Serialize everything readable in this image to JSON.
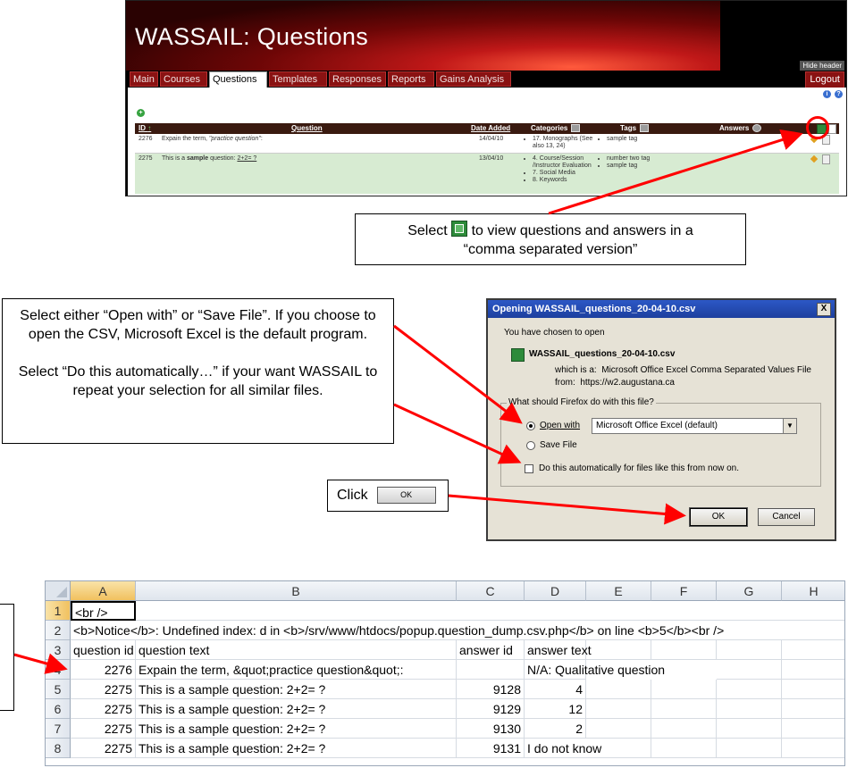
{
  "wassail": {
    "title": "WASSAIL: Questions",
    "hide_header": "Hide header",
    "tabs": [
      "Main",
      "Courses",
      "Questions",
      "Templates",
      "Responses",
      "Reports",
      "Gains Analysis"
    ],
    "active_tab": "Questions",
    "logout": "Logout",
    "table_headers": {
      "id": "ID",
      "question": "Question",
      "date_added": "Date Added",
      "categories": "Categories",
      "tags": "Tags",
      "answers": "Answers"
    },
    "rows": [
      {
        "id": "2276",
        "question_prefix": "Expain the term, ",
        "question_em": "\"practice question\"",
        "question_suffix": ":",
        "date": "14/04/10",
        "categories": [
          "17. Monographs (See also 13, 24)"
        ],
        "tags": [
          "sample tag"
        ]
      },
      {
        "id": "2275",
        "question_prefix": "This is a ",
        "question_bold": "sample",
        "question_mid": " question: ",
        "question_link": "2+2= ?",
        "date": "13/04/10",
        "categories": [
          "4. Course/Session /Instructor Evaluation",
          "7. Social Media",
          "8. Keywords"
        ],
        "tags": [
          "number two tag",
          "sample tag"
        ]
      }
    ],
    "colors": {
      "banner": "#a01010",
      "tab": "#8a1212",
      "row_highlight": "#d7ebd2",
      "header": "#3a1a10"
    }
  },
  "callouts": {
    "select_pre": "Select",
    "select_post_line1": "to view questions and answers in a",
    "select_line2": "“comma separated version”",
    "open_save": "Select either “Open with” or “Save File”. If you choose to open the CSV, Microsoft Excel is the default program.",
    "automatic": "Select “Do this automatically…” if your want WASSAIL to repeat your selection for all similar files.",
    "click": "Click",
    "click_ok_btn": "OK"
  },
  "dialog": {
    "title": "Opening WASSAIL_questions_20-04-10.csv",
    "close": "X",
    "chosen": "You have chosen to open",
    "filename": "WASSAIL_questions_20-04-10.csv",
    "which_label": "which is a:",
    "which_value": "Microsoft Office Excel Comma Separated Values File",
    "from_label": "from:",
    "from_value": "https://w2.augustana.ca",
    "legend": "What should Firefox do with this file?",
    "open_with": "Open with",
    "open_with_app": "Microsoft Office Excel (default)",
    "save_file": "Save File",
    "auto": "Do this automatically for files like this from now on.",
    "ok": "OK",
    "cancel": "Cancel"
  },
  "spreadsheet": {
    "columns": [
      "A",
      "B",
      "C",
      "D",
      "E",
      "F",
      "G",
      "H"
    ],
    "rows": [
      {
        "n": "1",
        "A": "<br />"
      },
      {
        "n": "2",
        "A": "<b>Notice</b>:  Undefined index:  d in <b>/srv/www/htdocs/popup.question_dump.csv.php</b> on line <b>5</b><br />"
      },
      {
        "n": "3",
        "A": "question id",
        "B": "question text",
        "C": "answer id",
        "D": "answer text"
      },
      {
        "n": "4",
        "A": "2276",
        "B": "Expain the term, &quot;practice question&quot;:",
        "D": "N/A: Qualitative question"
      },
      {
        "n": "5",
        "A": "2275",
        "B": "This is a sample question: 2+2= ?",
        "C": "9128",
        "D": "4"
      },
      {
        "n": "6",
        "A": "2275",
        "B": "This is a sample question: 2+2= ?",
        "C": "9129",
        "D": "12"
      },
      {
        "n": "7",
        "A": "2275",
        "B": "This is a sample question: 2+2= ?",
        "C": "9130",
        "D": "2"
      },
      {
        "n": "8",
        "A": "2275",
        "B": "This is a sample question: 2+2= ?",
        "C": "9131",
        "D": "I do not know"
      }
    ]
  }
}
